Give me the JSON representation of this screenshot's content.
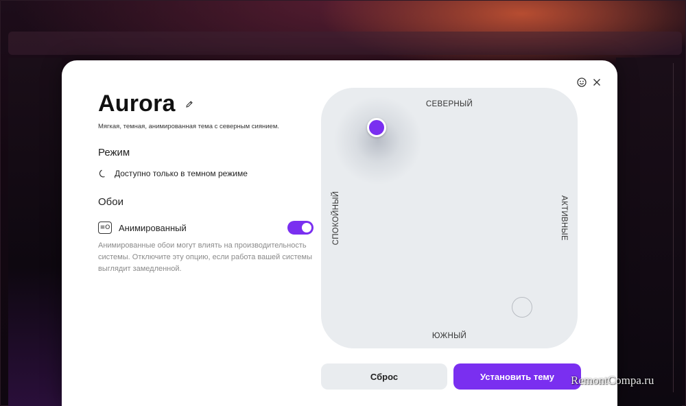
{
  "theme": {
    "title": "Aurora",
    "subtitle": "Мягкая, темная, анимированная тема с северным сиянием."
  },
  "mode": {
    "heading": "Режим",
    "value": "Доступно только в темном режиме"
  },
  "wallpaper": {
    "heading": "Обои",
    "icon_text": "≡O",
    "animated_label": "Анимированный",
    "animated_enabled": true,
    "description": "Анимированные обои могут влиять на производительность системы. Отключите эту опцию, если работа вашей системы выглядит замедленной."
  },
  "mood_pad": {
    "north": "СЕВЕРНЫЙ",
    "south": "ЮЖНЫЙ",
    "west": "СПОКОЙНЫЙ",
    "east": "АКТИВНЫЕ"
  },
  "buttons": {
    "reset": "Сброс",
    "apply": "Установить тему"
  },
  "colors": {
    "accent": "#7a2ff0",
    "pad_bg": "#e9ecef"
  },
  "icons": {
    "edit": "pencil-icon",
    "moon": "moon-icon",
    "smile": "smile-icon",
    "close": "close-icon"
  },
  "watermark": "RemontCompa.ru"
}
